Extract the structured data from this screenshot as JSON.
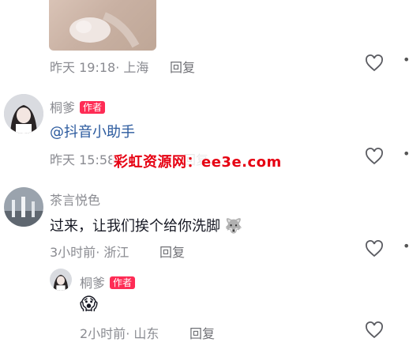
{
  "comments": [
    {
      "meta_time": "昨天 19:18",
      "meta_location": "· 上海",
      "reply_label": "回复"
    },
    {
      "username": "桐爹",
      "badge": "作者",
      "mention": "@抖音小助手",
      "meta": "昨天 15:58",
      "reply_label": "回复"
    },
    {
      "username": "茶言悦色",
      "text": "过来，让我们挨个给你洗脚",
      "emoji": "🐺",
      "meta_time": "3小时前",
      "meta_location": "· 浙江",
      "reply_label": "回复"
    },
    {
      "username": "桐爹",
      "badge": "作者",
      "emoji": "😱",
      "meta_time": "2小时前",
      "meta_location": "· 山东",
      "reply_label": "回复"
    }
  ],
  "watermark": "彩虹资源网：ee3e.com",
  "colors": {
    "badge_red": "#fe2c55",
    "mention_blue": "#2b5a9e",
    "watermark_red": "#e60012",
    "meta_gray": "#8a8b91"
  }
}
